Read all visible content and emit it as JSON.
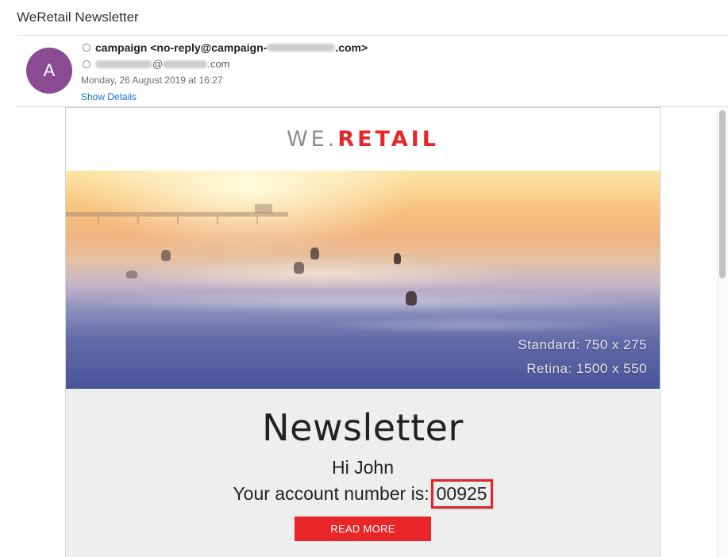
{
  "subject": "WeRetail Newsletter",
  "sender": {
    "avatar_letter": "A",
    "from_prefix": "campaign <no-reply@campaign-",
    "from_suffix": ".com>",
    "to_at": "@",
    "to_suffix": ".com",
    "date": "Monday, 26 August 2019 at 16:27",
    "show_details": "Show Details",
    "avatar_color": "#8a4b93"
  },
  "email": {
    "logo_we": "WE.",
    "logo_retail": "RETAIL",
    "hero_caption_standard": "Standard: 750 x 275",
    "hero_caption_retina": "Retina: 1500 x 550",
    "title": "Newsletter",
    "greeting": "Hi John",
    "account_label": "Your account number is:",
    "account_number": "00925",
    "button_label": "READ MORE",
    "brand_red": "#e8262a"
  },
  "icons": {
    "from_status": "radio-circle-icon",
    "to_status": "radio-circle-icon"
  }
}
